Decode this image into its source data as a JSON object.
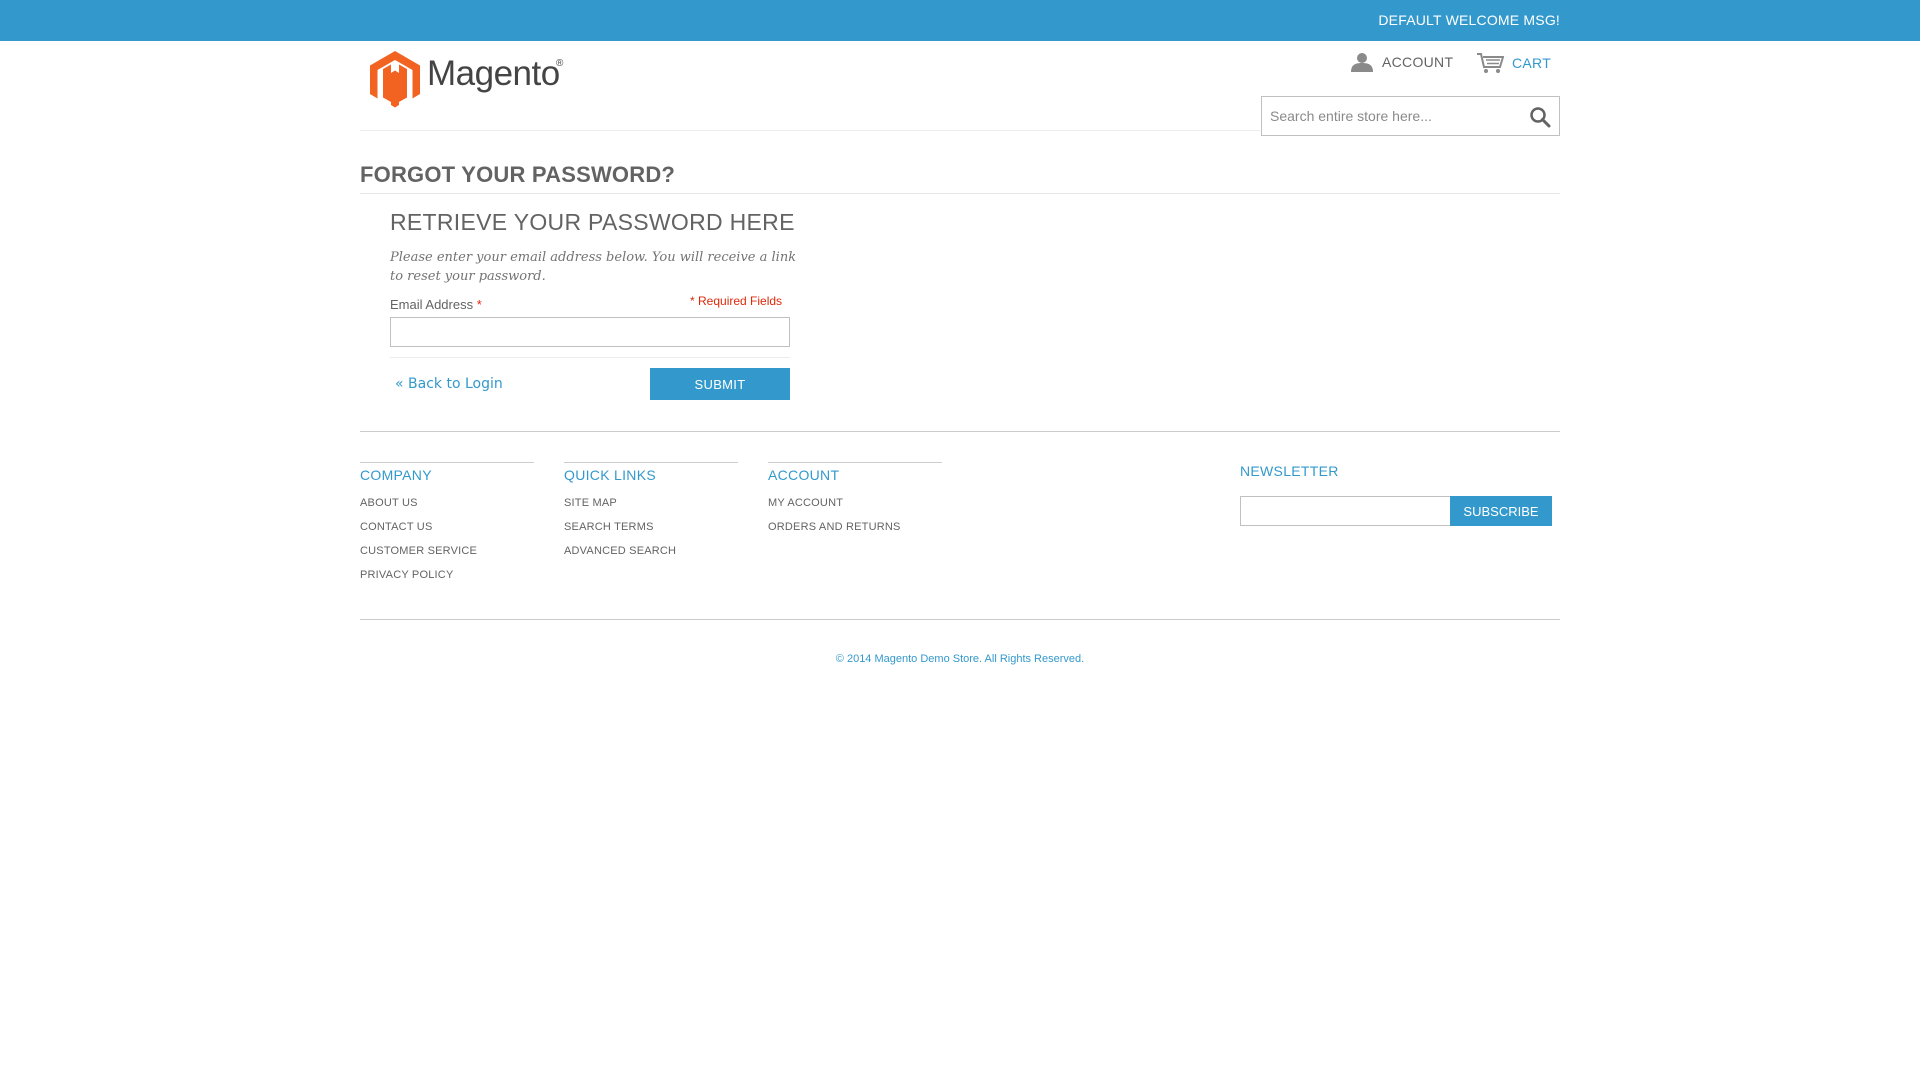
{
  "colors": {
    "accent": "#3399cc",
    "logo_orange": "#f26322",
    "required": "#df280a"
  },
  "topbar": {
    "welcome": "DEFAULT WELCOME MSG!"
  },
  "header": {
    "logo_text": "Magento",
    "logo_reg": "®",
    "account_label": "ACCOUNT",
    "cart_label": "CART",
    "account_icon": "person-icon",
    "cart_icon": "cart-icon"
  },
  "search": {
    "placeholder": "Search entire store here...",
    "value": "",
    "icon": "search-icon"
  },
  "page": {
    "title": "FORGOT YOUR PASSWORD?",
    "subtitle": "RETRIEVE YOUR PASSWORD HERE",
    "intro": "Please enter your email address below. You will receive a link to reset your password.",
    "email_label": "Email Address",
    "required_star": "*",
    "required_text": "Required Fields",
    "email_value": "",
    "back_link": "« Back to Login",
    "submit_label": "SUBMIT"
  },
  "footer": {
    "columns": [
      {
        "title": "COMPANY",
        "links": [
          "ABOUT US",
          "CONTACT US",
          "CUSTOMER SERVICE",
          "PRIVACY POLICY"
        ]
      },
      {
        "title": "QUICK LINKS",
        "links": [
          "SITE MAP",
          "SEARCH TERMS",
          "ADVANCED SEARCH"
        ]
      },
      {
        "title": "ACCOUNT",
        "links": [
          "MY ACCOUNT",
          "ORDERS AND RETURNS"
        ]
      }
    ],
    "newsletter": {
      "title": "NEWSLETTER",
      "value": "",
      "button": "SUBSCRIBE"
    },
    "copyright": "© 2014 Magento Demo Store. All Rights Reserved."
  }
}
